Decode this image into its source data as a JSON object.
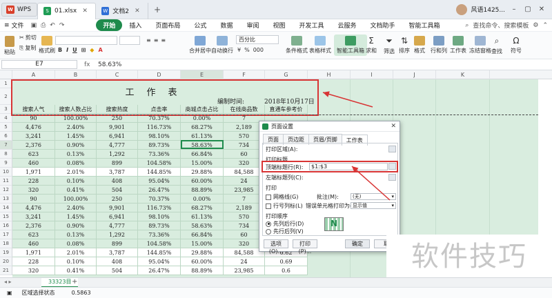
{
  "titlebar": {
    "app_tab": "WPS",
    "doc_tabs": [
      {
        "label": "01.xlsx",
        "active": true
      },
      {
        "label": "文档2",
        "active": false
      }
    ],
    "new_tab": "+",
    "user": "风语1425..."
  },
  "menubar": {
    "file": "文件",
    "items": [
      "开始",
      "插入",
      "页面布局",
      "公式",
      "数据",
      "审阅",
      "视图",
      "开发工具",
      "云服务",
      "文档助手",
      "智能工具箱"
    ],
    "active": "开始",
    "search_placeholder": "查找命令、搜索模板"
  },
  "ribbon": {
    "paste": "粘贴",
    "cut": "剪切",
    "copy": "复制",
    "format_painter": "格式刷",
    "merge_center": "合并居中",
    "auto_wrap": "自动换行",
    "number_format": "百分比",
    "conditional_format": "条件格式",
    "table_style": "表格样式",
    "smart_toolbox": "智能工具箱",
    "sum": "求和",
    "filter": "筛选",
    "sort": "排序",
    "format": "格式",
    "row_col": "行和列",
    "worksheet": "工作表",
    "freeze": "冻结窗格",
    "find": "查找",
    "symbol": "符号"
  },
  "formula": {
    "namebox": "E7",
    "fx": "fx",
    "value": "58.63%"
  },
  "columns": [
    "A",
    "B",
    "C",
    "D",
    "E",
    "F",
    "G",
    "H",
    "I",
    "J",
    "K"
  ],
  "sheet": {
    "title": "工作表",
    "date_label": "编制时间:",
    "date_value": "2018年10月17日",
    "headers": [
      "搜索人气",
      "搜索人数占比",
      "搜索热度",
      "点击率",
      "商城点击占比",
      "在线商品数",
      "直通车参考价"
    ],
    "rows": [
      {
        "n": "4",
        "c": [
          "90",
          "100.00%",
          "250",
          "70.37%",
          "0.00%",
          "7",
          ""
        ]
      },
      {
        "n": "5",
        "c": [
          "4,476",
          "2.40%",
          "9,901",
          "116.73%",
          "68.27%",
          "2,189",
          ""
        ]
      },
      {
        "n": "6",
        "c": [
          "3,241",
          "1.45%",
          "6,941",
          "98.10%",
          "61.13%",
          "570",
          ""
        ]
      },
      {
        "n": "7",
        "c": [
          "2,376",
          "0.90%",
          "4,777",
          "89.73%",
          "58.63%",
          "734",
          ""
        ]
      },
      {
        "n": "8",
        "c": [
          "623",
          "0.13%",
          "1,292",
          "73.36%",
          "66.84%",
          "60",
          ""
        ]
      },
      {
        "n": "9",
        "c": [
          "460",
          "0.08%",
          "899",
          "104.58%",
          "15.00%",
          "320",
          ""
        ]
      },
      {
        "n": "10",
        "c": [
          "1,971",
          "2.01%",
          "3,787",
          "144.85%",
          "29.88%",
          "84,588",
          ""
        ]
      },
      {
        "n": "11",
        "c": [
          "228",
          "0.10%",
          "408",
          "95.04%",
          "60.00%",
          "24",
          ""
        ]
      },
      {
        "n": "12",
        "c": [
          "320",
          "0.41%",
          "504",
          "26.47%",
          "88.89%",
          "23,985",
          ""
        ]
      },
      {
        "n": "13",
        "c": [
          "90",
          "100.00%",
          "250",
          "70.37%",
          "0.00%",
          "7",
          ""
        ]
      },
      {
        "n": "14",
        "c": [
          "4,476",
          "2.40%",
          "9,901",
          "116.73%",
          "68.27%",
          "2,189",
          ""
        ]
      },
      {
        "n": "15",
        "c": [
          "3,241",
          "1.45%",
          "6,941",
          "98.10%",
          "61.13%",
          "570",
          ""
        ]
      },
      {
        "n": "16",
        "c": [
          "2,376",
          "0.90%",
          "4,777",
          "89.73%",
          "58.63%",
          "734",
          ""
        ]
      },
      {
        "n": "17",
        "c": [
          "623",
          "0.13%",
          "1,292",
          "73.36%",
          "66.84%",
          "60",
          ""
        ]
      },
      {
        "n": "18",
        "c": [
          "460",
          "0.08%",
          "899",
          "104.58%",
          "15.00%",
          "320",
          ""
        ]
      },
      {
        "n": "19",
        "c": [
          "1,971",
          "2.01%",
          "3,787",
          "144.85%",
          "29.88%",
          "84,588",
          "0.62"
        ]
      },
      {
        "n": "20",
        "c": [
          "228",
          "0.10%",
          "408",
          "95.04%",
          "60.00%",
          "24",
          "0.69"
        ]
      },
      {
        "n": "21",
        "c": [
          "320",
          "0.41%",
          "504",
          "26.47%",
          "88.89%",
          "23,985",
          "0.6"
        ]
      }
    ]
  },
  "dialog": {
    "title": "页面设置",
    "tabs": [
      "页面",
      "页边距",
      "页眉/页脚",
      "工作表"
    ],
    "active_tab": "工作表",
    "print_area_label": "打印区域(A):",
    "print_titles_label": "打印标题",
    "top_rows_label": "顶端标题行(R):",
    "top_rows_value": "$1:$3",
    "left_cols_label": "左端标题列(C):",
    "print_label": "打印",
    "gridlines_label": "网格线(G)",
    "row_col_headers_label": "行号列标(L)",
    "comments_label": "批注(M):",
    "comments_value": "(无)",
    "errors_label": "错误单元格打印为(E):",
    "errors_value": "显示值",
    "order_label": "打印顺序",
    "down_then_over": "先列后行(D)",
    "over_then_down": "先行后列(V)",
    "options_btn": "选项(O)...",
    "print_btn": "打印(P)...",
    "ok_btn": "确定",
    "cancel_btn": "取"
  },
  "sheetbar": {
    "sheet_name": "33323目",
    "add": "+"
  },
  "status": {
    "mode": "区域选择状态",
    "value": "0.5863"
  },
  "watermark": "软件技巧",
  "colors": {
    "accent": "#1e8b4c",
    "highlight_red": "#d83434",
    "sheet_green": "#d9eddf"
  }
}
